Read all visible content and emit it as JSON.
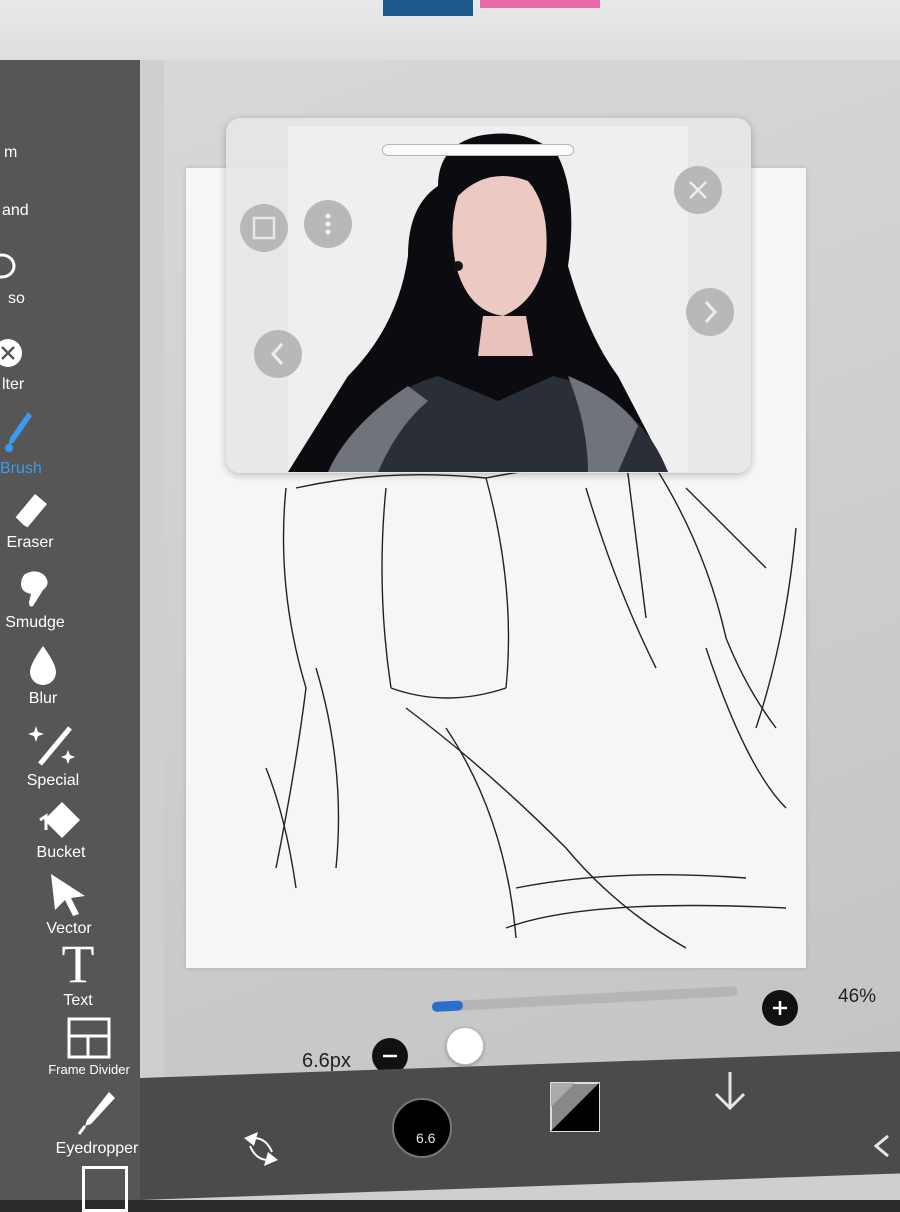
{
  "tools": [
    {
      "id": "transform",
      "label": "m"
    },
    {
      "id": "hand",
      "label": "and"
    },
    {
      "id": "lasso",
      "label": "so"
    },
    {
      "id": "filter",
      "label": "lter"
    },
    {
      "id": "brush",
      "label": "Brush"
    },
    {
      "id": "eraser",
      "label": "Eraser"
    },
    {
      "id": "smudge",
      "label": "Smudge"
    },
    {
      "id": "blur",
      "label": "Blur"
    },
    {
      "id": "special",
      "label": "Special"
    },
    {
      "id": "bucket",
      "label": "Bucket"
    },
    {
      "id": "vector",
      "label": "Vector"
    },
    {
      "id": "text",
      "label": "Text"
    },
    {
      "id": "frame_divider",
      "label": "Frame Divider"
    },
    {
      "id": "eyedropper",
      "label": "Eyedropper"
    }
  ],
  "active_tool": "brush",
  "brush": {
    "size_label": "6.6px",
    "size_value": "6.6",
    "slider_fraction": 0.1
  },
  "zoom_label": "46%",
  "colors": {
    "accent": "#3b9bf0",
    "toolbar": "#565656",
    "bottom_bar": "#4b4b4b",
    "canvas_bg": "#cfcfcf"
  },
  "reference_window": {
    "icons": [
      "close-icon",
      "next-icon",
      "prev-icon",
      "square-icon",
      "more-icon"
    ]
  }
}
